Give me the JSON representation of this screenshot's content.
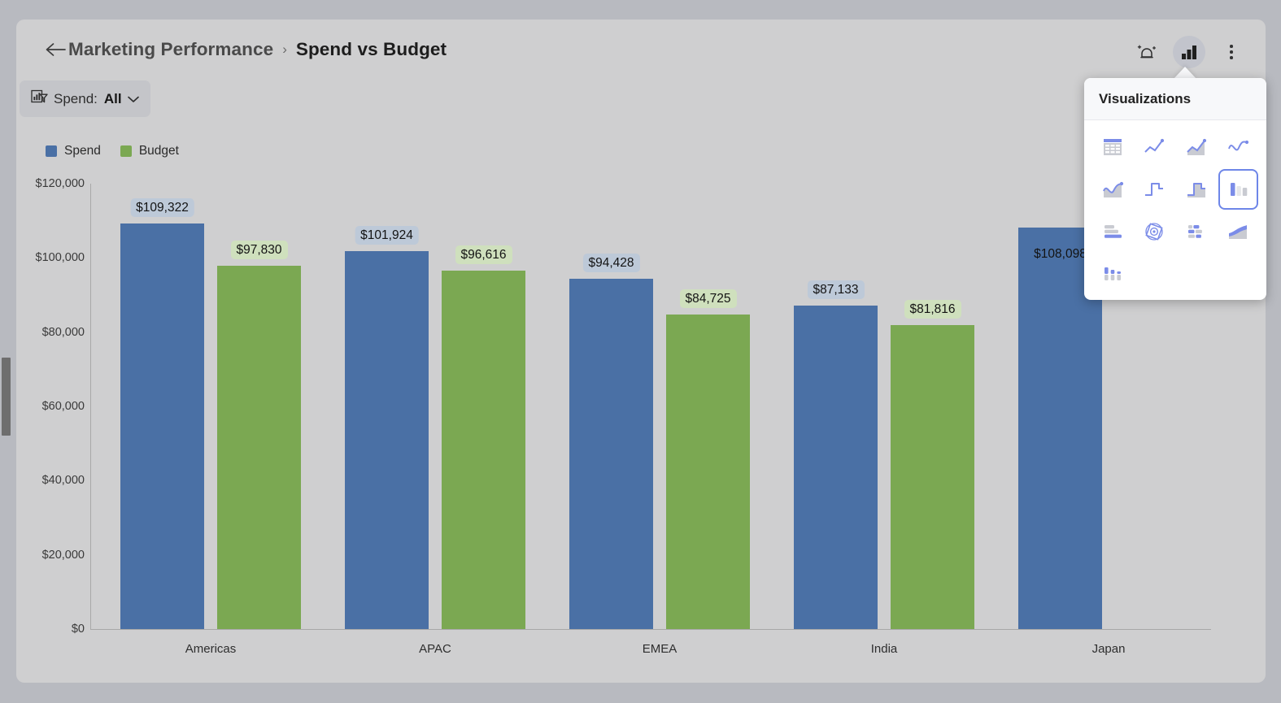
{
  "header": {
    "back_icon": "back-arrow-icon",
    "breadcrumb_parent": "Marketing Performance",
    "breadcrumb_separator": "›",
    "breadcrumb_current": "Spend vs Budget",
    "actions": [
      {
        "name": "ai-insights-icon",
        "label": "AI insights",
        "active": false
      },
      {
        "name": "visualizations-icon",
        "label": "Visualizations",
        "active": true
      },
      {
        "name": "more-options-icon",
        "label": "More options",
        "active": false
      }
    ]
  },
  "filter": {
    "icon": "filter-chart-icon",
    "label": "Spend:",
    "value": "All",
    "chevron": "chevron-down-icon"
  },
  "viz_panel": {
    "title": "Visualizations",
    "items": [
      {
        "name": "table",
        "selected": false
      },
      {
        "name": "line",
        "selected": false
      },
      {
        "name": "area-line",
        "selected": false
      },
      {
        "name": "spline",
        "selected": false
      },
      {
        "name": "spline-area",
        "selected": false
      },
      {
        "name": "step-line",
        "selected": false
      },
      {
        "name": "step-area",
        "selected": false
      },
      {
        "name": "column",
        "selected": true
      },
      {
        "name": "bar",
        "selected": false
      },
      {
        "name": "pie",
        "selected": false
      },
      {
        "name": "stacked-bar",
        "selected": false
      },
      {
        "name": "stacked-area",
        "selected": false
      },
      {
        "name": "grouped-column",
        "selected": false
      }
    ]
  },
  "chart_data": {
    "type": "bar",
    "title": "Spend vs Budget",
    "xlabel": "",
    "ylabel": "",
    "categories": [
      "Americas",
      "APAC",
      "EMEA",
      "India",
      "Japan"
    ],
    "series": [
      {
        "name": "Spend",
        "color": "#4a70a5",
        "label_chip_color": "#bdc9d8",
        "values": [
          109322,
          101924,
          94428,
          87133,
          108098
        ],
        "labels": [
          "$109,322",
          "$101,924",
          "$94,428",
          "$87,133",
          "$108,098"
        ]
      },
      {
        "name": "Budget",
        "color": "#7ba852",
        "label_chip_color": "#cfe0bd",
        "values": [
          97830,
          96616,
          84725,
          81816,
          null
        ],
        "labels": [
          "$97,830",
          "$96,616",
          "$84,725",
          "$81,816",
          ""
        ]
      }
    ],
    "ylim": [
      0,
      120000
    ],
    "yticks": [
      0,
      20000,
      40000,
      60000,
      80000,
      100000,
      120000
    ],
    "ytick_labels": [
      "$0",
      "$20,000",
      "$40,000",
      "$60,000",
      "$80,000",
      "$100,000",
      "$120,000"
    ],
    "grid": false,
    "legend_position": "top-left",
    "legend": [
      "Spend",
      "Budget"
    ]
  }
}
